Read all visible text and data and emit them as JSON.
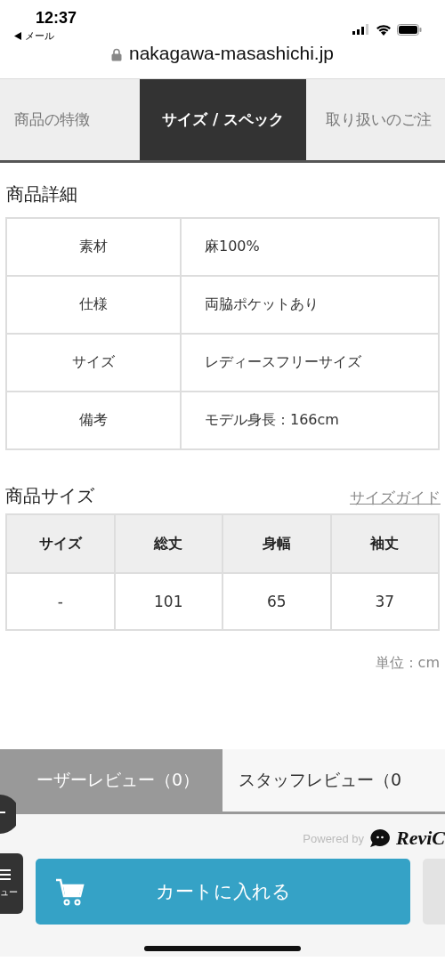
{
  "status_bar": {
    "time": "12:37",
    "back_label": "メール"
  },
  "address_bar": {
    "url": "nakagawa-masashichi.jp"
  },
  "tabs": [
    {
      "label": "商品の特徴",
      "selected": false
    },
    {
      "label": "サイズ / スペック",
      "selected": true
    },
    {
      "label": "取り扱いのご注",
      "selected": false
    }
  ],
  "details": {
    "title": "商品詳細",
    "rows": [
      {
        "label": "素材",
        "value": "麻100%"
      },
      {
        "label": "仕様",
        "value": "両脇ポケットあり"
      },
      {
        "label": "サイズ",
        "value": "レディースフリーサイズ"
      },
      {
        "label": "備考",
        "value": "モデル身長：166cm"
      }
    ]
  },
  "sizes": {
    "title": "商品サイズ",
    "guide_link": "サイズガイド",
    "columns": [
      "サイズ",
      "総丈",
      "身幅",
      "袖丈"
    ],
    "rows": [
      [
        "-",
        "101",
        "65",
        "37"
      ]
    ],
    "unit": "単位：cm"
  },
  "review_tabs": [
    {
      "label": "ーザーレビュー（0）",
      "selected": true
    },
    {
      "label": "スタッフレビュー（0",
      "selected": false
    }
  ],
  "powered_by": {
    "text": "Powered by",
    "brand": "ReviC"
  },
  "bottom_bar": {
    "menu_label": "ュー",
    "cart_button": "カートに入れる"
  }
}
